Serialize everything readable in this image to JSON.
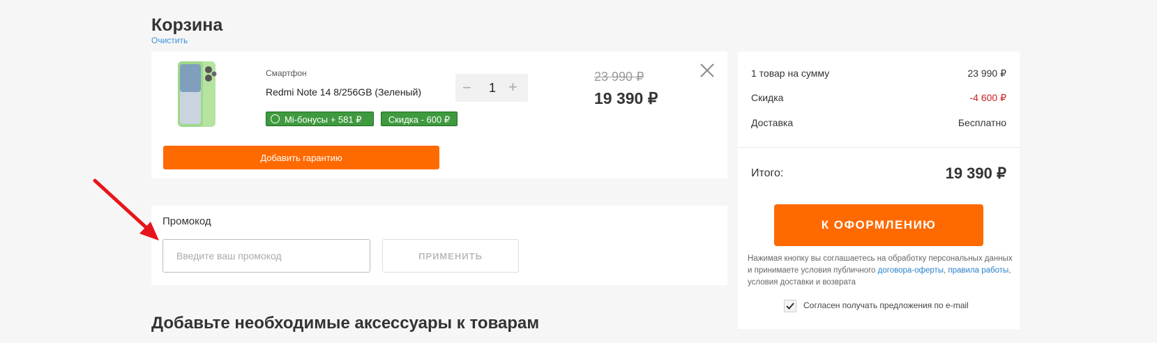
{
  "cart": {
    "title": "Корзина",
    "clear_label": "Очистить"
  },
  "product": {
    "category": "Смартфон",
    "name": "Redmi Note 14 8/256GB (Зеленый)",
    "bonus_badge": "Mi-бонусы + 581 ₽",
    "discount_badge": "Скидка - 600 ₽",
    "warranty_button": "Добавить гарантию",
    "quantity": "1",
    "qty_minus": "−",
    "qty_plus": "+",
    "old_price": "23 990 ₽",
    "price": "19 390 ₽"
  },
  "promo": {
    "title": "Промокод",
    "placeholder": "Введите ваш промокод",
    "apply_label": "ПРИМЕНИТЬ"
  },
  "accessories_title": "Добавьте необходимые аксессуары к товарам",
  "summary": {
    "items_label": "1 товар на сумму",
    "items_value": "23 990 ₽",
    "discount_label": "Скидка",
    "discount_value": "-4 600 ₽",
    "delivery_label": "Доставка",
    "delivery_value": "Бесплатно",
    "total_label": "Итого:",
    "total_value": "19 390 ₽",
    "checkout_button": "К ОФОРМЛЕНИЮ",
    "legal_text_1": "Нажимая кнопку вы соглашаетесь на обработку персональных данных и принимаете условия публичного ",
    "legal_link_1": "договора-оферты",
    "legal_text_2": ", ",
    "legal_link_2": "правила работы",
    "legal_text_3": ", условия доставки и возврата",
    "consent_label": "Согласен получать предложения по e-mail",
    "consent_checked": true
  },
  "colors": {
    "accent": "#ff6a00",
    "bonus_green": "#3f9a3f",
    "discount_red": "#cc1f1f",
    "link_blue": "#2a7fc9",
    "annotation_arrow": "#e8141b"
  }
}
